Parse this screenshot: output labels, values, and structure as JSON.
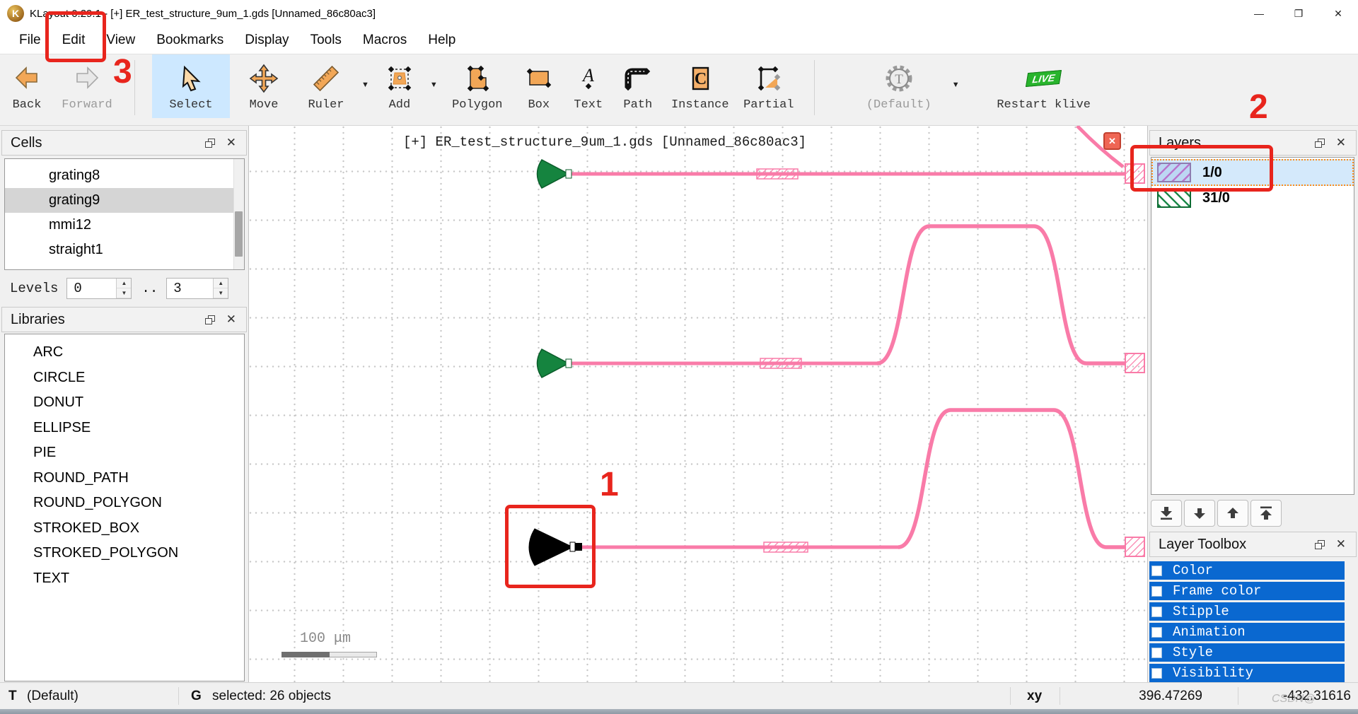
{
  "window": {
    "title": "KLayout 0.29.1 - [+] ER_test_structure_9um_1.gds [Unnamed_86c80ac3]",
    "controls": {
      "minimize": "—",
      "maximize": "❐",
      "close": "✕"
    }
  },
  "menu": {
    "items": [
      "File",
      "Edit",
      "View",
      "Bookmarks",
      "Display",
      "Tools",
      "Macros",
      "Help"
    ]
  },
  "toolbar": {
    "items": [
      {
        "label": "Back"
      },
      {
        "label": "Forward"
      },
      {
        "label": "Select"
      },
      {
        "label": "Move"
      },
      {
        "label": "Ruler"
      },
      {
        "label": "Add"
      },
      {
        "label": "Polygon"
      },
      {
        "label": "Box"
      },
      {
        "label": "Text"
      },
      {
        "label": "Path"
      },
      {
        "label": "Instance"
      },
      {
        "label": "Partial"
      },
      {
        "label": "(Default)"
      },
      {
        "label": "Restart klive"
      }
    ],
    "live_badge": "LIVE",
    "dropdown_icons": [
      "ruler-dropdown-arrow-icon",
      "add-dropdown-arrow-icon",
      "default-dropdown-arrow-icon"
    ]
  },
  "cells_panel": {
    "title": "Cells",
    "items": [
      "grating8",
      "grating9",
      "mmi12",
      "straight1"
    ],
    "selected": "grating9"
  },
  "levels": {
    "label": "Levels",
    "from": "0",
    "separator": "..",
    "to": "3"
  },
  "libraries_panel": {
    "title": "Libraries",
    "items": [
      "ARC",
      "CIRCLE",
      "DONUT",
      "ELLIPSE",
      "PIE",
      "ROUND_PATH",
      "ROUND_POLYGON",
      "STROKED_BOX",
      "STROKED_POLYGON",
      "TEXT"
    ]
  },
  "canvas": {
    "tab_title": "[+] ER_test_structure_9um_1.gds [Unnamed_86c80ac3]",
    "close_glyph": "✕",
    "scale_bar_label": "100 μm"
  },
  "layers_panel": {
    "title": "Layers",
    "layers": [
      {
        "name": "1/0"
      },
      {
        "name": "31/0"
      }
    ],
    "selected": "1/0",
    "move_buttons": [
      "move-to-bottom-icon",
      "move-down-icon",
      "move-up-icon",
      "move-to-top-icon"
    ]
  },
  "layer_toolbox": {
    "title": "Layer Toolbox",
    "rows": [
      "Color",
      "Frame color",
      "Stipple",
      "Animation",
      "Style",
      "Visibility"
    ]
  },
  "statusbar": {
    "tech_key": "T",
    "tech_value": "(Default)",
    "mode_key": "G",
    "selection": "selected: 26 objects",
    "xy_label": "xy",
    "x_value": "396.47269",
    "y_value": "-432.31616",
    "watermark": "CSDN@"
  },
  "annotations": {
    "step1": "1",
    "step2": "2",
    "step3": "3"
  },
  "colors": {
    "waveguide_pink": "#f97ba8",
    "coupler_green": "#15843f",
    "selected_shape_black": "#000000",
    "layer1_fill": "#bdd7f3",
    "layer1_hatch": "#b875cc",
    "layer31_hatch": "#1d8a4a",
    "toolbox_blue": "#0a68d0",
    "annotation_red": "#e8251d",
    "selection_blue": "#d4e9fb",
    "live_green": "#28b42c"
  }
}
